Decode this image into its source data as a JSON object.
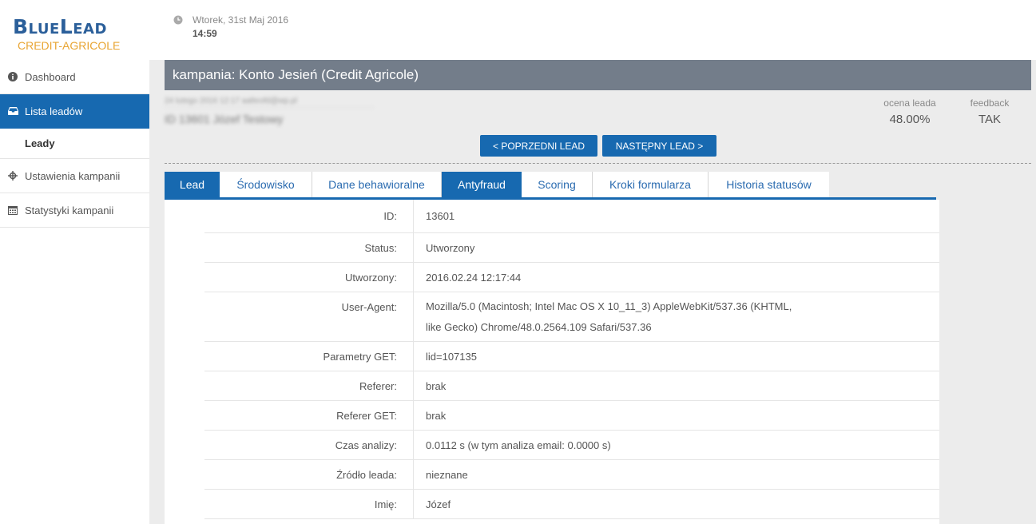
{
  "logo": {
    "main": "BlueLead",
    "sub": "CREDIT-AGRICOLE"
  },
  "datetime": {
    "date": "Wtorek, 31st Maj 2016",
    "time": "14:59",
    "icon": "clock-icon"
  },
  "sidebar": {
    "items": [
      {
        "label": "Dashboard",
        "icon": "info-icon"
      },
      {
        "label": "Lista leadów",
        "icon": "inbox-icon"
      },
      {
        "label": "Leady"
      },
      {
        "label": "Ustawienia kampanii",
        "icon": "crosshair-icon"
      },
      {
        "label": "Statystyki kampanii",
        "icon": "calendar-icon"
      }
    ]
  },
  "campaign": {
    "title": "kampania: Konto Jesień (Credit Agricole)"
  },
  "lead": {
    "blurred_line1": "24 lutego 2016 12:17 aalteofd@wp.pl",
    "blurred_line2": "ID 13601 Józef Testowy",
    "score_label": "ocena leada",
    "score_value": "48.00%",
    "feedback_label": "feedback",
    "feedback_value": "TAK"
  },
  "buttons": {
    "prev": "< POPRZEDNI LEAD",
    "next": "NASTĘPNY LEAD >"
  },
  "tabs": [
    {
      "label": "Lead",
      "active": true
    },
    {
      "label": "Środowisko"
    },
    {
      "label": "Dane behawioralne"
    },
    {
      "label": "Antyfraud",
      "active": true
    },
    {
      "label": "Scoring"
    },
    {
      "label": "Kroki formularza"
    },
    {
      "label": "Historia statusów"
    }
  ],
  "details": [
    {
      "label": "ID:",
      "value": "13601"
    },
    {
      "label": "Status:",
      "value": "Utworzony"
    },
    {
      "label": "Utworzony:",
      "value": "2016.02.24 12:17:44"
    },
    {
      "label": "User-Agent:",
      "value": "Mozilla/5.0 (Macintosh; Intel Mac OS X 10_11_3) AppleWebKit/537.36 (KHTML, like Gecko) Chrome/48.0.2564.109 Safari/537.36"
    },
    {
      "label": "Parametry GET:",
      "value": "lid=107135"
    },
    {
      "label": "Referer:",
      "value": "brak"
    },
    {
      "label": "Referer GET:",
      "value": "brak"
    },
    {
      "label": "Czas analizy:",
      "value": "0.0112 s (w tym analiza email: 0.0000 s)"
    },
    {
      "label": "Źródło leada:",
      "value": "nieznane"
    },
    {
      "label": "Imię:",
      "value": "Józef"
    }
  ],
  "colors": {
    "primary": "#1769b0",
    "title_bar": "#737d8a",
    "logo_blue": "#2b5f9a",
    "logo_orange": "#e8a431"
  }
}
